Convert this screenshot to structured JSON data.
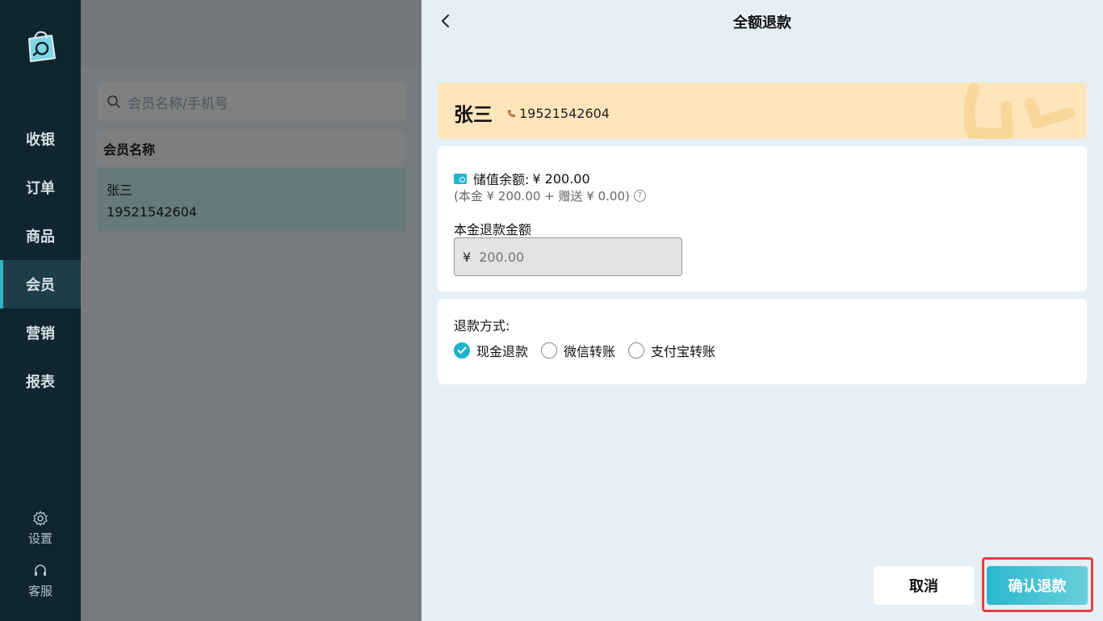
{
  "sidebar": {
    "logo": "shopping-bag-logo",
    "items": [
      {
        "label": "收银"
      },
      {
        "label": "订单"
      },
      {
        "label": "商品"
      },
      {
        "label": "会员",
        "active": true
      },
      {
        "label": "营销"
      },
      {
        "label": "报表"
      }
    ],
    "settings_label": "设置",
    "support_label": "客服"
  },
  "member_list": {
    "search_placeholder": "会员名称/手机号",
    "column_header": "会员名称",
    "rows": [
      {
        "name": "张三",
        "phone": "19521542604"
      }
    ]
  },
  "refund_panel": {
    "title": "全额退款",
    "member": {
      "name": "张三",
      "phone": "19521542604"
    },
    "balance": {
      "label": "储值余额:",
      "value": "¥ 200.00",
      "breakdown": "(本金 ¥ 200.00 + 赠送 ¥ 0.00)"
    },
    "amount": {
      "label": "本金退款金额",
      "currency": "¥",
      "placeholder": "200.00"
    },
    "method": {
      "label": "退款方式:",
      "options": [
        {
          "label": "现金退款",
          "checked": true
        },
        {
          "label": "微信转账",
          "checked": false
        },
        {
          "label": "支付宝转账",
          "checked": false
        }
      ]
    },
    "cancel_label": "取消",
    "confirm_label": "确认退款"
  },
  "colors": {
    "accent": "#1fb3cb",
    "sidebar_bg": "#0f2530",
    "member_card_bg": "#fde5bb",
    "highlight_border": "#e8403d"
  }
}
